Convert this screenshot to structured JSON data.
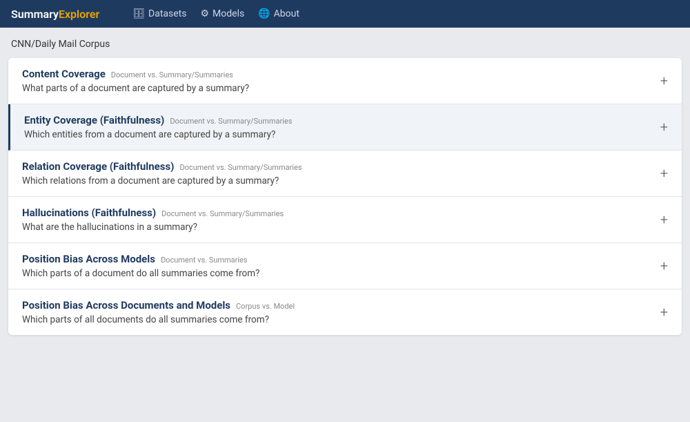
{
  "navbar": {
    "brand_summary": "Summary",
    "brand_explorer": "Explorer",
    "nav_datasets_icon": "🗄",
    "nav_datasets_label": "Datasets",
    "nav_models_icon": "⚙",
    "nav_models_label": "Models",
    "nav_about_icon": "🌐",
    "nav_about_label": "About"
  },
  "breadcrumb": "CNN/Daily Mail Corpus",
  "accordion": {
    "items": [
      {
        "title": "Content Coverage",
        "tag": "Document vs. Summary/Summaries",
        "description": "What parts of a document are captured by a summary?",
        "active": false
      },
      {
        "title": "Entity Coverage (Faithfulness)",
        "tag": "Document vs. Summary/Summaries",
        "description": "Which entities from a document are captured by a summary?",
        "active": true
      },
      {
        "title": "Relation Coverage (Faithfulness)",
        "tag": "Document vs. Summary/Summaries",
        "description": "Which relations from a document are captured by a summary?",
        "active": false
      },
      {
        "title": "Hallucinations (Faithfulness)",
        "tag": "Document vs. Summary/Summaries",
        "description": "What are the hallucinations in a summary?",
        "active": false
      },
      {
        "title": "Position Bias Across Models",
        "tag": "Document vs. Summaries",
        "description": "Which parts of a document do all summaries come from?",
        "active": false
      },
      {
        "title": "Position Bias Across Documents and Models",
        "tag": "Corpus vs. Model",
        "description": "Which parts of all documents do all summaries come from?",
        "active": false
      }
    ]
  }
}
